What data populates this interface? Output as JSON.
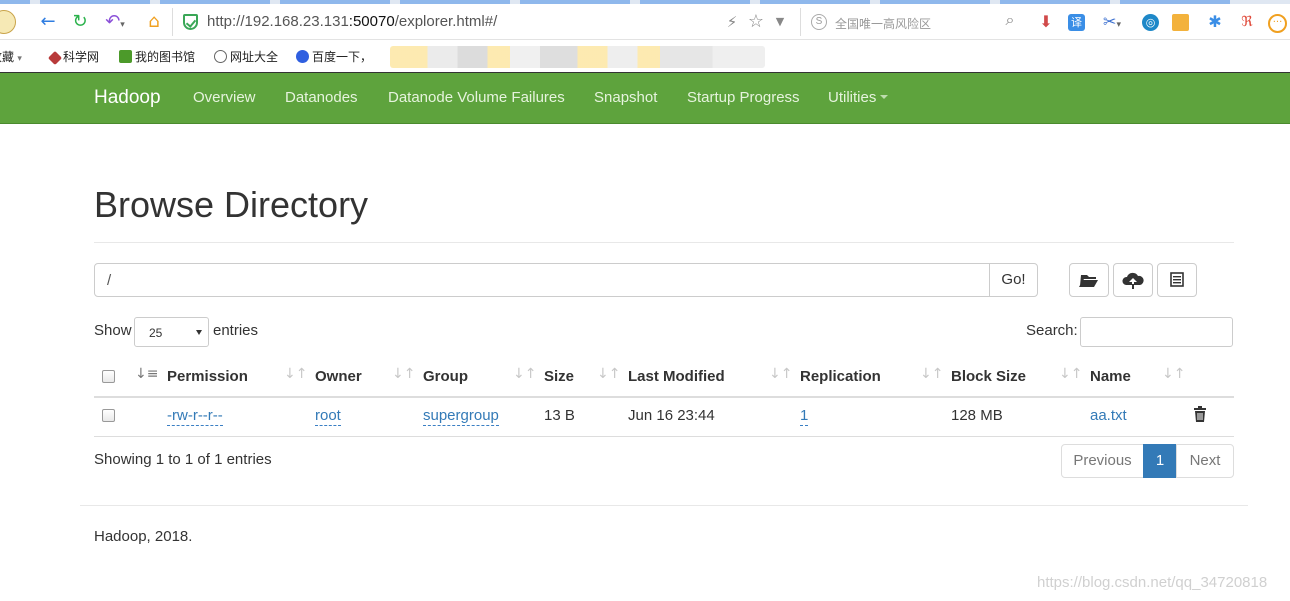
{
  "browser": {
    "url_host": "http://192.168.23.131",
    "url_port": ":50070",
    "url_path": "/explorer.html#/",
    "search_placeholder": "全国唯一高风险区",
    "bookmarks": [
      {
        "label": "收藏",
        "icon": "star-icon"
      },
      {
        "label": "科学网",
        "icon": "sciencenet-icon"
      },
      {
        "label": "我的图书馆",
        "icon": "library-icon"
      },
      {
        "label": "网址大全",
        "icon": "globe-icon"
      },
      {
        "label": "百度一下，",
        "icon": "baidu-paw-icon"
      }
    ]
  },
  "navbar": {
    "brand": "Hadoop",
    "links": [
      "Overview",
      "Datanodes",
      "Datanode Volume Failures",
      "Snapshot",
      "Startup Progress",
      "Utilities"
    ]
  },
  "page": {
    "title": "Browse Directory",
    "path_value": "/",
    "go_label": "Go!",
    "show_label": "Show",
    "page_length": "25",
    "entries_label": "entries",
    "search_label": "Search:",
    "columns": [
      "Permission",
      "Owner",
      "Group",
      "Size",
      "Last Modified",
      "Replication",
      "Block Size",
      "Name"
    ],
    "rows": [
      {
        "permission": "-rw-r--r--",
        "owner": "root",
        "group": "supergroup",
        "size": "13 B",
        "last_modified": "Jun 16 23:44",
        "replication": "1",
        "block_size": "128 MB",
        "name": "aa.txt"
      }
    ],
    "info": "Showing 1 to 1 of 1 entries",
    "pagination": {
      "previous": "Previous",
      "current": "1",
      "next": "Next"
    },
    "footer": "Hadoop, 2018."
  },
  "watermark": "https://blog.csdn.net/qq_34720818",
  "colors": {
    "navbar": "#5ea33d",
    "link": "#337ab7",
    "pager_active": "#337ab7"
  }
}
